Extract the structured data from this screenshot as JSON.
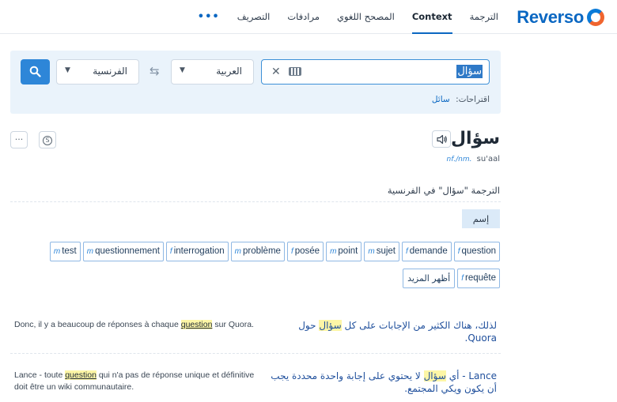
{
  "header": {
    "logo_text": "Reverso",
    "nav": [
      "الترجمة",
      "Context",
      "المصحح اللغوي",
      "مرادفات",
      "التصريف",
      "•••"
    ],
    "active_nav": "Context"
  },
  "search": {
    "query": "سؤال",
    "source_lang": "العربية",
    "target_lang": "الفرنسية",
    "suggestions_label": "اقتراحات:",
    "suggestion": "سائل"
  },
  "entry": {
    "word": "سؤال",
    "pos_tag": "nf./nm.",
    "transliteration": "su'aal",
    "section_title": "الترجمة \"سؤال\" في الفرنسية",
    "pos_badge": "إسم",
    "translations_row1": [
      {
        "g": "f",
        "w": "question"
      },
      {
        "g": "f",
        "w": "demande"
      },
      {
        "g": "m",
        "w": "sujet"
      },
      {
        "g": "m",
        "w": "point"
      },
      {
        "g": "f",
        "w": "posée"
      },
      {
        "g": "m",
        "w": "problème"
      },
      {
        "g": "f",
        "w": "interrogation"
      },
      {
        "g": "m",
        "w": "questionnement"
      },
      {
        "g": "m",
        "w": "test"
      }
    ],
    "translations_row2": [
      {
        "g": "f",
        "w": "requête"
      }
    ],
    "show_more": "أظهر المزيد"
  },
  "examples": [
    {
      "fr_before": "Donc, il y a beaucoup de réponses à chaque ",
      "fr_hl": "question",
      "fr_after": " sur Quora.",
      "ar_before": "لذلك، هناك الكثير من الإجابات على كل ",
      "ar_hl": "سؤال",
      "ar_after": " حول Quora."
    },
    {
      "fr_before": "Lance - toute ",
      "fr_hl": "question",
      "fr_after": " qui n'a pas de réponse unique et définitive doit être un wiki communautaire.",
      "ar_before": "Lance - أي ",
      "ar_hl": "سؤال",
      "ar_after": " لا يحتوي على إجابة واحدة محددة يجب أن يكون ويكي المجتمع."
    }
  ],
  "colors": {
    "brand": "#0a67c2",
    "accent": "#2e86d8",
    "highlight": "#fdf6a6",
    "panel": "#eaf3fb"
  }
}
